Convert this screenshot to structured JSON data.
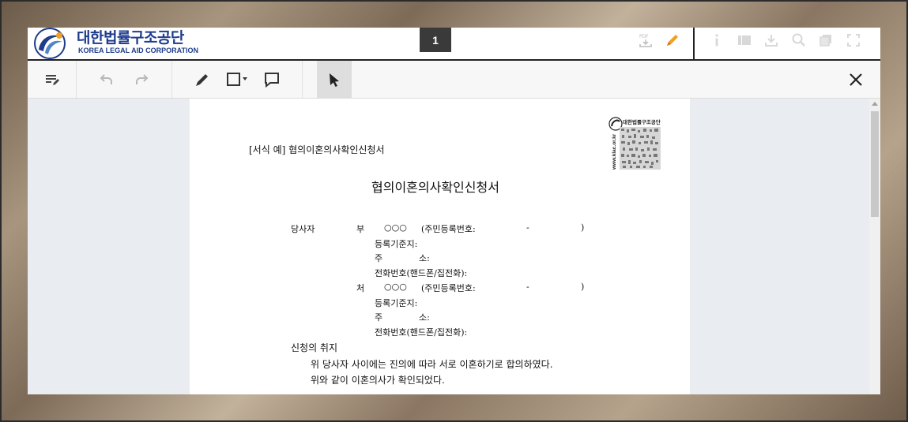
{
  "header": {
    "brand_ko": "대한법률구조공단",
    "brand_en": "KOREA LEGAL AID CORPORATION",
    "page_number": "1",
    "pdf_badge": "PDF"
  },
  "colors": {
    "brand": "#1e3c8c",
    "accent": "#f0a020",
    "toolbar_bg": "#f7f7f7",
    "content_bg": "#e9edf1"
  },
  "document": {
    "form_label": "[서식 예] 협의이혼의사확인신청서",
    "title": "협의이혼의사확인신청서",
    "qr_label": "대한법률구조공단",
    "qr_url": "www.klac.or.kr",
    "party_label": "당사자",
    "husband": {
      "role": "부",
      "name": "○○○",
      "id_label": "(주민등록번호:",
      "id_dash": "-",
      "id_close": ")",
      "registry": "등록기준지:",
      "address_a": "주",
      "address_b": "소:",
      "phone": "전화번호(핸드폰/집전화):"
    },
    "wife": {
      "role": "처",
      "name": "○○○",
      "id_label": "(주민등록번호:",
      "id_dash": "-",
      "id_close": ")",
      "registry": "등록기준지:",
      "address_a": "주",
      "address_b": "소:",
      "phone": "전화번호(핸드폰/집전화):"
    },
    "purpose_heading": "신청의 취지",
    "purpose_line1": "위 당사자 사이에는 진의에 따라 서로 이혼하기로 합의하였다.",
    "purpose_line2": "위와 같이 이혼의사가 확인되었다."
  }
}
